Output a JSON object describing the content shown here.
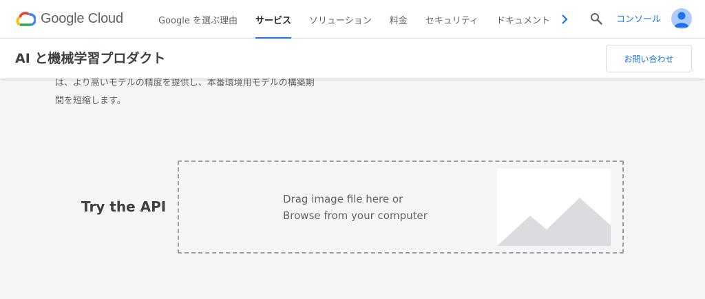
{
  "brand": {
    "name": "Google Cloud",
    "colors": {
      "blue": "#4285F4",
      "red": "#EA4335",
      "yellow": "#FBBC04",
      "green": "#34A853"
    }
  },
  "nav": {
    "links": [
      {
        "label": "Google を選ぶ理由",
        "active": false
      },
      {
        "label": "サービス",
        "active": true
      },
      {
        "label": "ソリューション",
        "active": false
      },
      {
        "label": "料金",
        "active": false
      },
      {
        "label": "セキュリティ",
        "active": false
      },
      {
        "label": "ドキュメント",
        "active": false
      }
    ],
    "more_icon": "chevron-right-icon",
    "search_icon": "search-icon",
    "console_label": "コンソール",
    "avatar_icon": "account-icon"
  },
  "subheader": {
    "title": "AI と機械学習プロダクト",
    "contact_label": "お問い合わせ"
  },
  "content": {
    "para_line1": "は、より高いモデルの精度を提供し、本番環境用モデルの構築期",
    "para_line2": "間を短縮します。"
  },
  "try_api": {
    "label": "Try the API",
    "drop_line1": "Drag image file here or",
    "drop_line2": "Browse from your computer",
    "placeholder_icon": "image-placeholder-icon"
  },
  "colors": {
    "accent": "#1a73e8",
    "page_bg": "#f5f5f5",
    "placeholder_shape": "#dadce0"
  }
}
